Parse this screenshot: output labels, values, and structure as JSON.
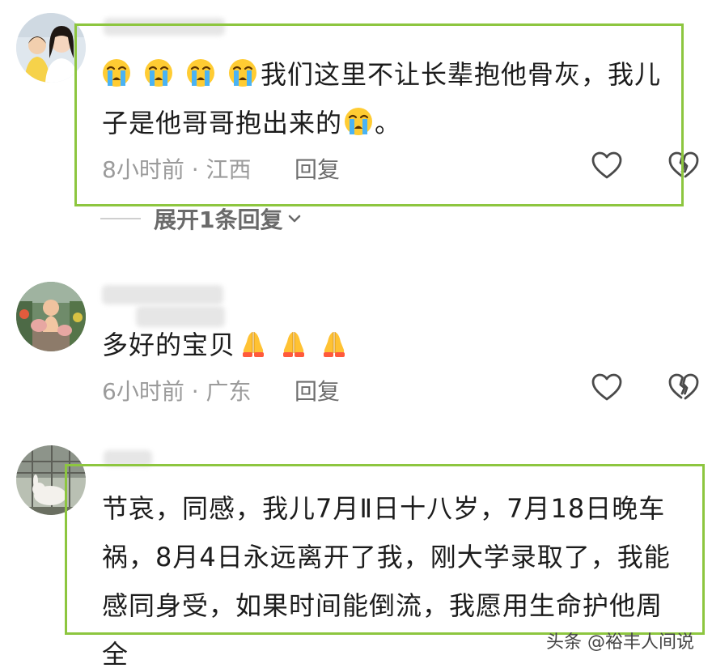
{
  "comments": [
    {
      "text_line1": "我们这里不让长辈抱他骨灰，我儿",
      "text_line2_a": "子是他哥哥抱出来的",
      "text_line2_b": "。",
      "time_location": "8小时前 · 江西",
      "reply_label": "回复",
      "emoji": "crying-face-emoji"
    },
    {
      "text": "多好的宝贝",
      "time_location": "6小时前 · 广东",
      "reply_label": "回复",
      "emoji": "folded-hands-emoji"
    },
    {
      "lines": [
        "节哀，同感，我儿7月Ⅱ日十八岁，7月18日晚车",
        "祸，8月4日永远离开了我，刚大学录取了，我能",
        "感同身受，如果时间能倒流，我愿用生命护他周",
        "全"
      ]
    }
  ],
  "expand_replies": {
    "label": "展开1条回复",
    "icon": "chevron-down-icon"
  },
  "watermark": "头条 @裕丰人间说",
  "colors": {
    "highlight_border": "#8dc63f",
    "meta_text": "#9b9b9b"
  }
}
